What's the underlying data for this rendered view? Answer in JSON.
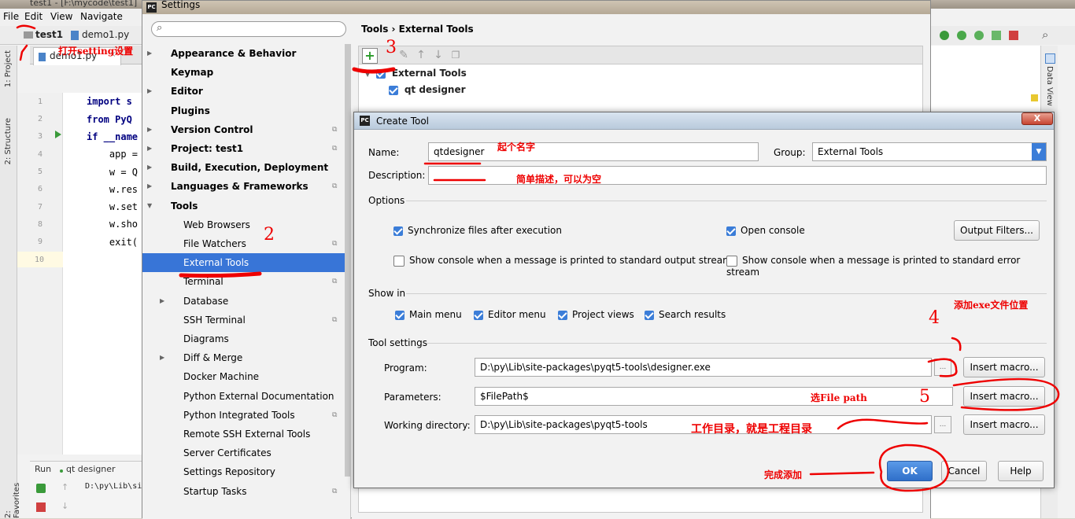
{
  "ide": {
    "title": "test1 - [F:\\mycode\\test1]",
    "menu": [
      "File",
      "Edit",
      "View",
      "Navigate"
    ],
    "nav_project": "test1",
    "nav_file": "demo1.py",
    "tab_file": "demo1.py",
    "left_tabs": [
      "1: Project",
      "2: Structure",
      "2: Favorites"
    ],
    "right_tab": "Data View",
    "line_numbers": [
      "1",
      "2",
      "3",
      "4",
      "5",
      "6",
      "7",
      "8",
      "9",
      "10"
    ],
    "code_lines": [
      "import s",
      "from PyQ",
      "if __name",
      "    app =",
      "    w = Q",
      "    w.res",
      "    w.set",
      "    w.sho",
      "    exit(",
      ""
    ],
    "run_label": "Run",
    "run_tab": "qt designer",
    "run_output": "D:\\py\\Lib\\si"
  },
  "settings": {
    "title": "Settings",
    "search_placeholder": "",
    "breadcrumb": "Tools › External Tools",
    "tree": [
      {
        "label": "Appearance & Behavior",
        "bold": true,
        "arrow": true,
        "indent": 0
      },
      {
        "label": "Keymap",
        "bold": true,
        "arrow": false,
        "indent": 0
      },
      {
        "label": "Editor",
        "bold": true,
        "arrow": true,
        "indent": 0
      },
      {
        "label": "Plugins",
        "bold": true,
        "arrow": false,
        "indent": 0
      },
      {
        "label": "Version Control",
        "bold": true,
        "arrow": true,
        "indent": 0,
        "project": true
      },
      {
        "label": "Project: test1",
        "bold": true,
        "arrow": true,
        "indent": 0,
        "project": true
      },
      {
        "label": "Build, Execution, Deployment",
        "bold": true,
        "arrow": true,
        "indent": 0
      },
      {
        "label": "Languages & Frameworks",
        "bold": true,
        "arrow": true,
        "indent": 0,
        "project": true
      },
      {
        "label": "Tools",
        "bold": true,
        "arrow": true,
        "expanded": true,
        "indent": 0
      },
      {
        "label": "Web Browsers",
        "bold": false,
        "arrow": false,
        "indent": 1
      },
      {
        "label": "File Watchers",
        "bold": false,
        "arrow": false,
        "indent": 1,
        "project": true
      },
      {
        "label": "External Tools",
        "bold": false,
        "arrow": false,
        "indent": 1,
        "selected": true
      },
      {
        "label": "Terminal",
        "bold": false,
        "arrow": false,
        "indent": 1,
        "project": true
      },
      {
        "label": "Database",
        "bold": false,
        "arrow": true,
        "indent": 1
      },
      {
        "label": "SSH Terminal",
        "bold": false,
        "arrow": false,
        "indent": 1,
        "project": true
      },
      {
        "label": "Diagrams",
        "bold": false,
        "arrow": false,
        "indent": 1
      },
      {
        "label": "Diff & Merge",
        "bold": false,
        "arrow": true,
        "indent": 1
      },
      {
        "label": "Docker Machine",
        "bold": false,
        "arrow": false,
        "indent": 1
      },
      {
        "label": "Python External Documentation",
        "bold": false,
        "arrow": false,
        "indent": 1
      },
      {
        "label": "Python Integrated Tools",
        "bold": false,
        "arrow": false,
        "indent": 1,
        "project": true
      },
      {
        "label": "Remote SSH External Tools",
        "bold": false,
        "arrow": false,
        "indent": 1
      },
      {
        "label": "Server Certificates",
        "bold": false,
        "arrow": false,
        "indent": 1
      },
      {
        "label": "Settings Repository",
        "bold": false,
        "arrow": false,
        "indent": 1
      },
      {
        "label": "Startup Tasks",
        "bold": false,
        "arrow": false,
        "indent": 1,
        "project": true
      }
    ],
    "ext_tools_group": "External Tools",
    "ext_tools_item": "qt designer"
  },
  "create_tool": {
    "title": "Create Tool",
    "close_label": "X",
    "name_label": "Name:",
    "name_value": "qtdesigner",
    "group_label": "Group:",
    "group_value": "External Tools",
    "description_label": "Description:",
    "description_value": "",
    "options_title": "Options",
    "sync_files": "Synchronize files after execution",
    "open_console": "Open console",
    "output_filters": "Output Filters...",
    "show_console_stdout": "Show console when a message is printed to standard output stream",
    "show_console_stderr": "Show console when a message is printed to standard error stream",
    "show_in_title": "Show in",
    "main_menu": "Main menu",
    "editor_menu": "Editor menu",
    "project_views": "Project views",
    "search_results": "Search results",
    "tool_settings_title": "Tool settings",
    "program_label": "Program:",
    "program_value": "D:\\py\\Lib\\site-packages\\pyqt5-tools\\designer.exe",
    "parameters_label": "Parameters:",
    "parameters_value": "$FilePath$",
    "workdir_label": "Working directory:",
    "workdir_value": "D:\\py\\Lib\\site-packages\\pyqt5-tools",
    "insert_macro": "Insert macro...",
    "browse": "...",
    "ok": "OK",
    "cancel": "Cancel",
    "help": "Help"
  },
  "annotations": {
    "open_settings": "打开setting设置",
    "step2": "2",
    "step3": "3",
    "step4": "4",
    "step5": "5",
    "name_hint": "起个名字",
    "desc_hint": "简单描述，可以为空",
    "exe_hint": "添加exe文件位置",
    "param_hint": "选File path",
    "workdir_hint": "工作目录，就是工程目录",
    "finish_hint": "完成添加"
  },
  "colors": {
    "accent": "#3875d7",
    "annotation": "#e00000"
  }
}
